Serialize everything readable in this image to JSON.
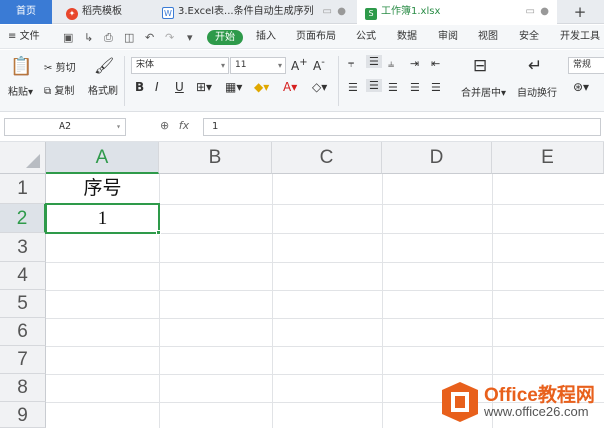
{
  "tabs": {
    "home": "首页",
    "template": "稻壳模板",
    "doc": "3.Excel表...条件自动生成序列",
    "active": "工作簿1.xlsx"
  },
  "menubar": {
    "file": "文件",
    "start": "开始",
    "items": [
      "插入",
      "页面布局",
      "公式",
      "数据",
      "审阅",
      "视图",
      "安全",
      "开发工具"
    ]
  },
  "ribbon": {
    "paste": "粘贴",
    "cut": "剪切",
    "copy": "复制",
    "format_painter": "格式刷",
    "font_name": "宋体",
    "font_size": "11",
    "bold": "B",
    "italic": "I",
    "underline": "U",
    "merge_center": "合并居中",
    "wrap_text": "自动换行",
    "number_format": "常规"
  },
  "formula_bar": {
    "name_box": "A2",
    "fx": "fx",
    "content": "1"
  },
  "sheet": {
    "columns": [
      "A",
      "B",
      "C",
      "D",
      "E"
    ],
    "rows": [
      "1",
      "2",
      "3",
      "4",
      "5",
      "6",
      "7",
      "8",
      "9"
    ],
    "a1": "序号",
    "a2": "1"
  },
  "watermark": {
    "brand": "Office教程网",
    "url": "www.office26.com"
  },
  "colors": {
    "accent_green": "#2e9a4a",
    "tab_blue": "#3a7bd5",
    "logo_orange": "#e8601c"
  }
}
